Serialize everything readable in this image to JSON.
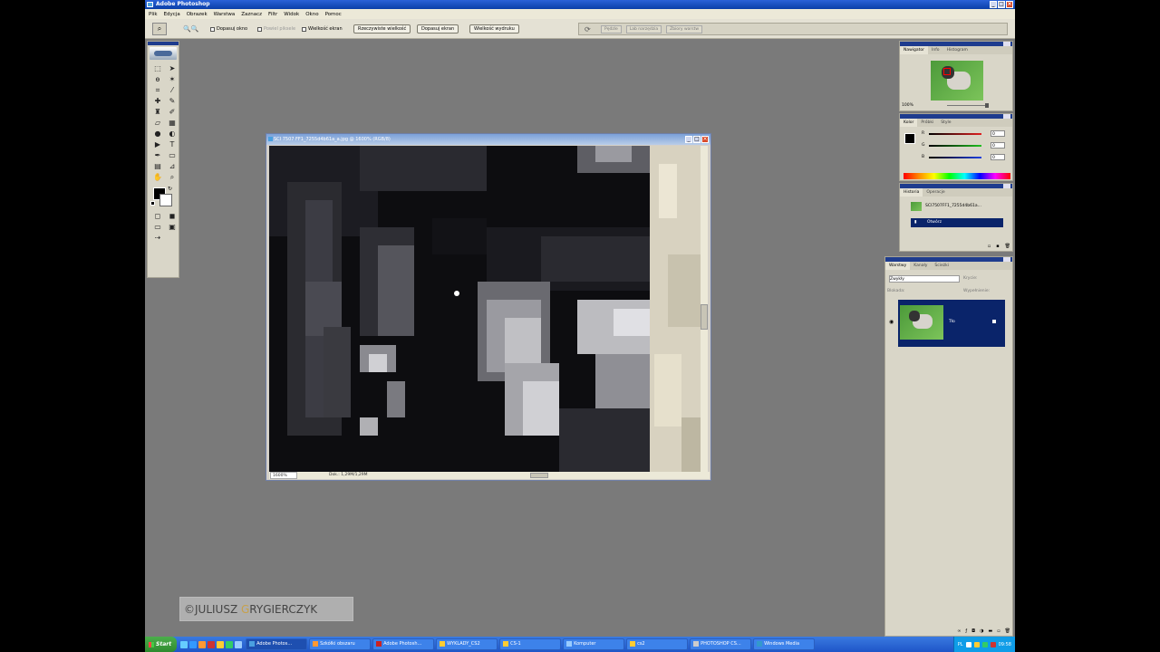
{
  "window": {
    "title": "Adobe Photoshop"
  },
  "menu": [
    "Plik",
    "Edycja",
    "Obrazek",
    "Warstwa",
    "Zaznacz",
    "Filtr",
    "Widok",
    "Okno",
    "Pomoc"
  ],
  "options": {
    "zoom_glyphs": "🔍🔍",
    "check1": "Dopasuj okno",
    "check2": "Powiel piksele",
    "check3": "Wielkość ekran",
    "btn1": "Rzeczywiste wielkość",
    "btn2": "Dopasuj ekran",
    "btn3": "Wielkość wydruku",
    "palette_tabs": [
      "Pędzle",
      "Lab narzędzia",
      "Zbiory warstw"
    ]
  },
  "document": {
    "title": "SCI 7507 FF1_7255d4b61a_a.jpg @ 1600% (RGB/8)",
    "zoom": "1600%",
    "status": "Dok.: 1,29M/1,29M"
  },
  "navigator": {
    "tabs": [
      "Nawigator",
      "Info",
      "Histogram"
    ],
    "zoom": "100%"
  },
  "color": {
    "tabs": [
      "Kolor",
      "Próbki",
      "Style"
    ],
    "rows": [
      {
        "label": "R",
        "value": "0",
        "color": "#e02020"
      },
      {
        "label": "G",
        "value": "0",
        "color": "#20c020"
      },
      {
        "label": "B",
        "value": "0",
        "color": "#2040e0"
      }
    ]
  },
  "history": {
    "tabs": [
      "Historia",
      "Operacje"
    ],
    "snapshot": "SCI7507FF1_7255d4b61a...",
    "active_step": "Otwórz"
  },
  "layers": {
    "tabs": [
      "Warstwy",
      "Kanały",
      "Ścieżki"
    ],
    "blend_mode": "Zwykły",
    "opacity_label": "Krycie:",
    "lock_label": "Blokada:",
    "fill_label": "Wypełnienie:",
    "layer_name": "Tło"
  },
  "watermark": {
    "prefix": "©JULIUSZ ",
    "g": "G",
    "suffix": "RYGIERCZYK"
  },
  "taskbar": {
    "start": "Start",
    "tasks": [
      "Adobe Photos...",
      "Szkółki obszaru",
      "Adobe Photosh...",
      "WYKLADY_CS2",
      "CS-1",
      "Komputer",
      "cs2",
      "PHOTOSHOP CS...",
      "Windows Media"
    ],
    "lang": "PL",
    "clock": "09:58"
  },
  "colors": {
    "accent": "#0a246a",
    "taskbar": "#1e55c8",
    "workspace": "#7a7a7a"
  }
}
